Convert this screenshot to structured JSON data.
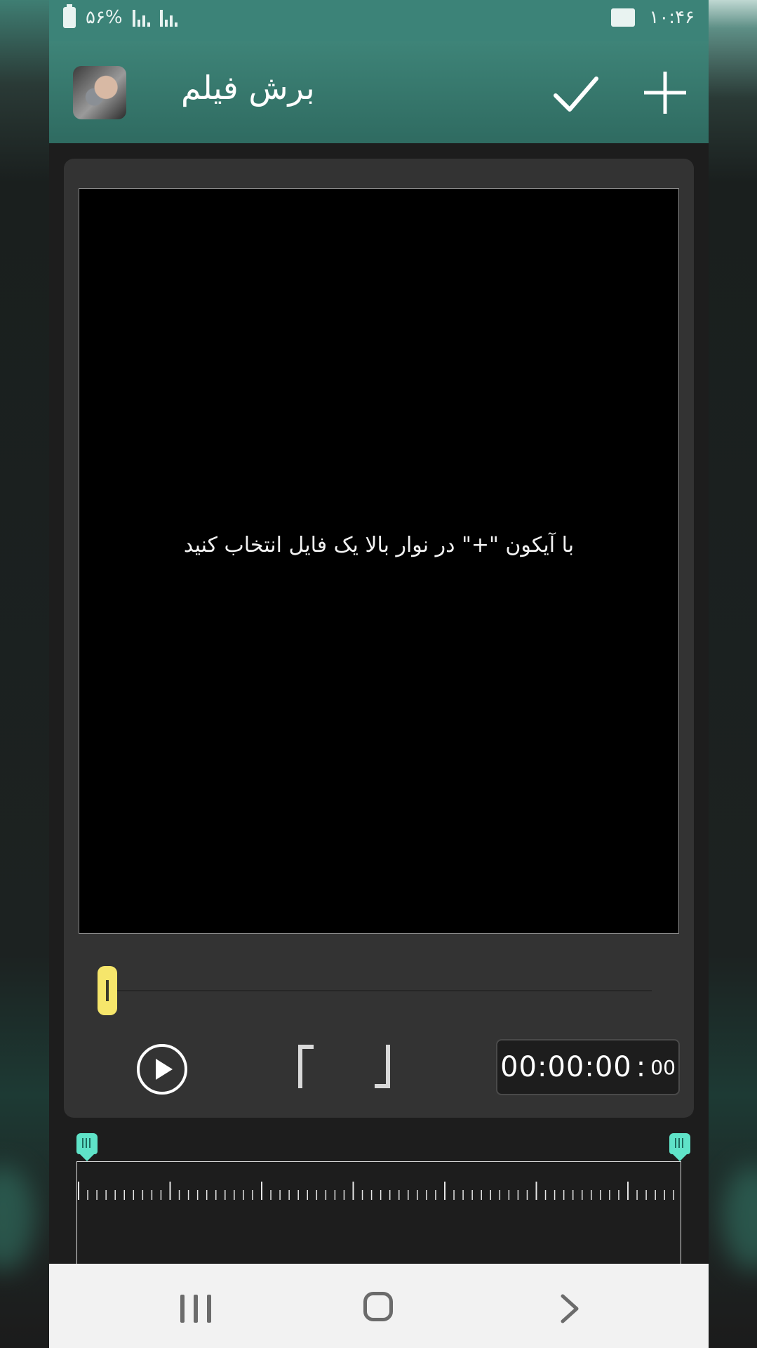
{
  "status_bar": {
    "battery": "۵۶%",
    "time": "۱۰:۴۶"
  },
  "app_bar": {
    "title": "برش فیلم",
    "confirm_icon": "check-icon",
    "add_icon": "plus-icon"
  },
  "viewer": {
    "hint": "با آیکون \"+\" در نوار بالا یک فایل انتخاب کنید"
  },
  "controls": {
    "seek_position": 0,
    "timecode_main": "00:00:00",
    "timecode_frames": "00"
  },
  "timeline": {
    "trim_start": 0,
    "trim_end": 1
  },
  "colors": {
    "accent": "#3c8378",
    "handle_yellow": "#f6e66b",
    "trim_handle": "#5fe3c8"
  }
}
